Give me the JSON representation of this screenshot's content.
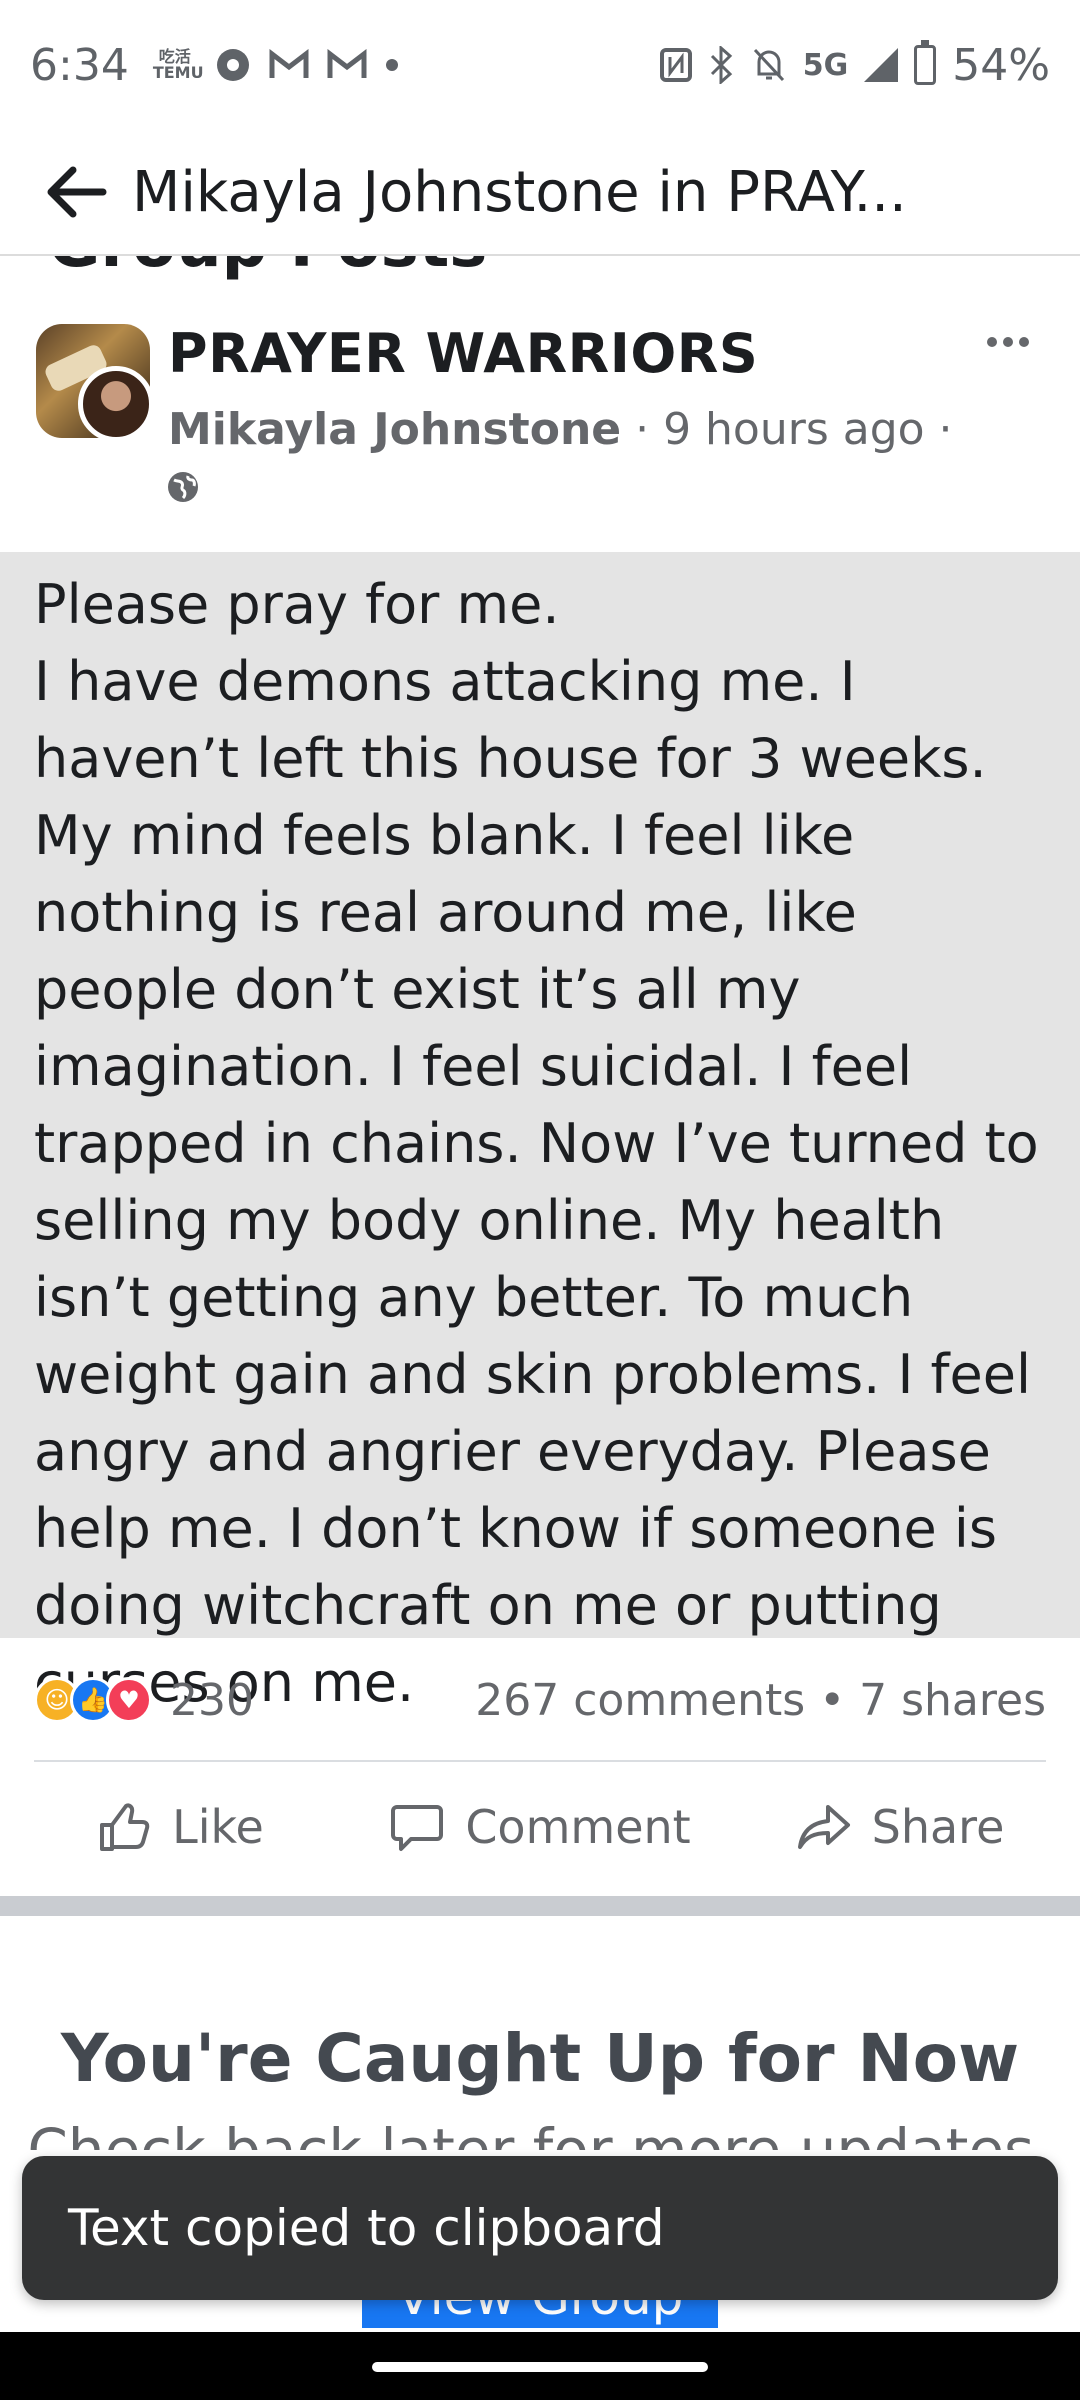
{
  "status_bar": {
    "time": "6:34",
    "left_icons": [
      "temu-icon",
      "chrome-icon",
      "gmail-icon",
      "gmail-icon",
      "dot-icon"
    ],
    "temu_label_top": "吃活",
    "temu_label_bottom": "TEMU",
    "network": "5G",
    "battery_percent": "54%"
  },
  "app_bar": {
    "title": "Mikayla Johnstone in PRAY..."
  },
  "partial_heading": "Group Posts",
  "post": {
    "group_name": "PRAYER WARRIORS",
    "author": "Mikayla Johnstone",
    "time_ago": " · 9 hours ago ·",
    "privacy_icon": "globe-icon",
    "text": "Please pray for me.\nI have demons attacking me. I haven’t left this house for 3 weeks. My mind feels blank. I feel like nothing is real around me, like people don’t exist it’s all my imagination. I feel suicidal. I feel trapped in chains. Now I’ve turned to selling my body online. My health isn’t getting any better. To much weight gain and skin problems. I feel angry and angrier everyday. Please help me. I don’t know if someone is doing witchcraft on me or putting curses on me.",
    "reaction_count": "230",
    "comments_shares": "267 comments • 7 shares",
    "actions": {
      "like": "Like",
      "comment": "Comment",
      "share": "Share"
    }
  },
  "feed_end": {
    "title": "You're Caught Up for Now",
    "subtitle": "Check back later for more updates.",
    "button": "View Group"
  },
  "toast": {
    "message": "Text copied to clipboard"
  },
  "colors": {
    "accent": "#1877f2",
    "post_background": "#e4e4e4",
    "toast_background": "#333435"
  }
}
